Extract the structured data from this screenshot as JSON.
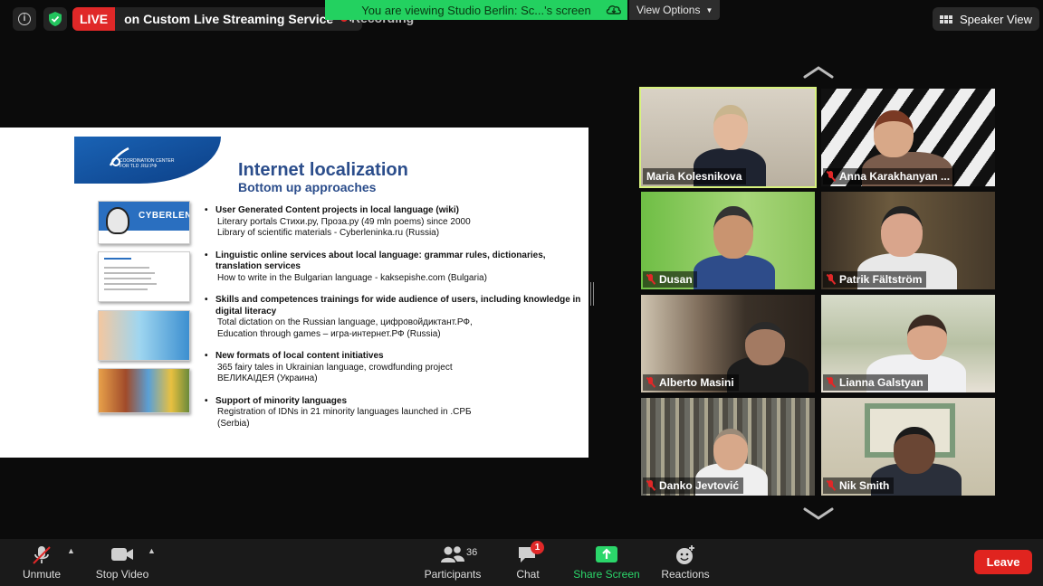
{
  "topbar": {
    "live_badge": "LIVE",
    "live_title": "on Custom Live Streaming Service",
    "recording_label": "Recording",
    "viewing_banner": "You are viewing Studio Berlin: Sc...'s screen",
    "view_options": "View Options",
    "speaker_view": "Speaker View"
  },
  "slide": {
    "logo_text_1": "COORDINATION CENTER",
    "logo_text_2": "FOR TLD .RU/.РФ",
    "title": "Internet localization",
    "subtitle": "Bottom up approaches",
    "thumb_1_label": "CYBERLENINKA",
    "bullets": [
      {
        "heading": "User Generated Content projects in local language (wiki)",
        "lines": [
          "Literary portals Стихи.ру, Проза.ру (49 mln poems) since 2000",
          "Library of scientific materials - Cyberleninka.ru (Russia)"
        ]
      },
      {
        "heading": "Linguistic online services about local language: grammar rules, dictionaries, translation services",
        "lines": [
          "How to write in the Bulgarian language - kaksepishe.com (Bulgaria)"
        ]
      },
      {
        "heading": "Skills and competences trainings for wide audience of users, including knowledge in digital literacy",
        "lines": [
          "Total dictation on the Russian language, цифровойдиктант.РФ,",
          "Education through games – игра-интернет.РФ (Russia)"
        ]
      },
      {
        "heading": "New formats of local content  initiatives",
        "lines": [
          "365 fairy tales in Ukrainian language, crowdfunding project",
          "ВЕЛИКАIДЕЯ (Украина)"
        ]
      },
      {
        "heading": "Support of minority languages",
        "lines": [
          "Registration of IDNs in 21 minority languages launched in .СРБ",
          "(Serbia)"
        ]
      }
    ]
  },
  "participants_gallery": [
    {
      "name": "Maria Kolesnikova",
      "muted": false,
      "active": true
    },
    {
      "name": "Anna Karakhanyan ...",
      "muted": true,
      "active": false
    },
    {
      "name": "Dusan",
      "muted": true,
      "active": false
    },
    {
      "name": "Patrik Fältström",
      "muted": true,
      "active": false
    },
    {
      "name": "Alberto Masini",
      "muted": true,
      "active": false
    },
    {
      "name": "Lianna Galstyan",
      "muted": true,
      "active": false
    },
    {
      "name": "Danko Jevtović",
      "muted": true,
      "active": false
    },
    {
      "name": "Nik Smith",
      "muted": true,
      "active": false
    }
  ],
  "toolbar": {
    "unmute": "Unmute",
    "stop_video": "Stop Video",
    "participants": "Participants",
    "participants_count": "36",
    "chat": "Chat",
    "chat_badge": "1",
    "share_screen": "Share Screen",
    "reactions": "Reactions",
    "leave": "Leave"
  },
  "colors": {
    "live_red": "#e02828",
    "banner_green": "#23d160",
    "active_speaker_outline": "#d8f27e",
    "share_green": "#2bd66a",
    "slide_title_blue": "#2b4d8b"
  },
  "icons": [
    "info-icon",
    "shield-check-icon",
    "cloud-icon",
    "chevron-down-icon",
    "grid-icon",
    "chevron-up-icon",
    "mic-muted-icon",
    "video-camera-icon",
    "participants-icon",
    "chat-icon",
    "share-screen-icon",
    "reactions-icon"
  ]
}
